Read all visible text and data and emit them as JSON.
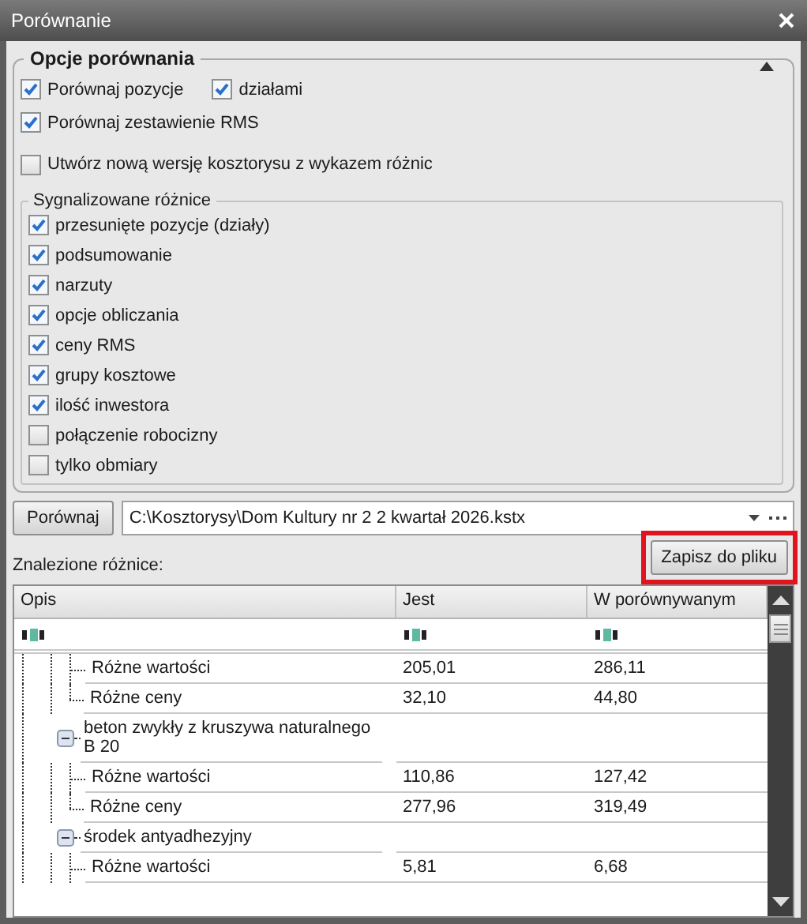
{
  "window": {
    "title": "Porównanie"
  },
  "options_group": {
    "title": "Opcje porównania",
    "rows": [
      {
        "items": [
          {
            "label": "Porównaj pozycje",
            "checked": true
          },
          {
            "label": "działami",
            "checked": true
          }
        ]
      },
      {
        "items": [
          {
            "label": "Porównaj zestawienie RMS",
            "checked": true
          }
        ]
      },
      {
        "items": [
          {
            "label": "Utwórz nową wersję kosztorysu z wykazem różnic",
            "checked": false
          }
        ]
      }
    ]
  },
  "differences_group": {
    "title": "Sygnalizowane różnice",
    "items": [
      {
        "label": "przesunięte pozycje (działy)",
        "checked": true
      },
      {
        "label": "podsumowanie",
        "checked": true
      },
      {
        "label": "narzuty",
        "checked": true
      },
      {
        "label": "opcje obliczania",
        "checked": true
      },
      {
        "label": "ceny RMS",
        "checked": true
      },
      {
        "label": "grupy kosztowe",
        "checked": true
      },
      {
        "label": "ilość inwestora",
        "checked": true
      },
      {
        "label": "połączenie robocizny",
        "checked": false
      },
      {
        "label": "tylko obmiary",
        "checked": false
      }
    ]
  },
  "compare_button": "Porównaj",
  "file_path": "C:\\Kosztorysy\\Dom Kultury nr 2 2 kwartał 2026.kstx",
  "save_button": {
    "label": "Zapisz do pliku",
    "highlighted": true
  },
  "results_label": "Znalezione różnice:",
  "table": {
    "columns": [
      "Opis",
      "Jest",
      "W porównywanym"
    ],
    "tree": [
      {
        "children": [
          {
            "label": "Różne wartości",
            "jest": "205,01",
            "compared": "286,11"
          },
          {
            "label": "Różne ceny",
            "jest": "32,10",
            "compared": "44,80"
          }
        ]
      },
      {
        "label": "beton zwykły z kruszywa naturalnego B 20",
        "expanded": true,
        "children": [
          {
            "label": "Różne wartości",
            "jest": "110,86",
            "compared": "127,42"
          },
          {
            "label": "Różne ceny",
            "jest": "277,96",
            "compared": "319,49"
          }
        ]
      },
      {
        "label": "środek antyadhezyjny",
        "expanded": true,
        "children": [
          {
            "label": "Różne wartości",
            "jest": "5,81",
            "compared": "6,68"
          }
        ]
      }
    ]
  }
}
